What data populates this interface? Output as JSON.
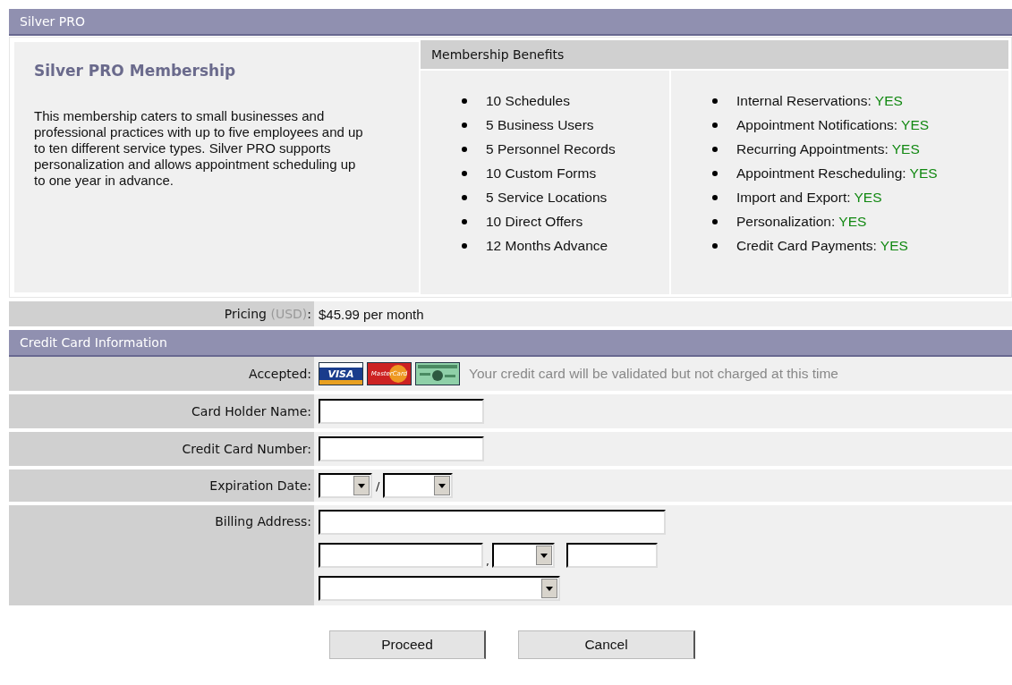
{
  "header": {
    "title": "Silver PRO"
  },
  "plan": {
    "title": "Silver PRO Membership",
    "description": "This membership caters to small businesses and professional practices with up to five employees and up to ten different service types. Silver PRO supports personalization and allows appointment scheduling up to one year in advance."
  },
  "benefits": {
    "title": "Membership Benefits",
    "limits": [
      "10 Schedules",
      "5 Business Users",
      "5 Personnel Records",
      "10 Custom Forms",
      "5 Service Locations",
      "10 Direct Offers",
      "12 Months Advance"
    ],
    "features": [
      {
        "label": "Internal Reservations:",
        "value": "YES"
      },
      {
        "label": "Appointment Notifications:",
        "value": "YES"
      },
      {
        "label": "Recurring Appointments:",
        "value": "YES"
      },
      {
        "label": "Appointment Rescheduling:",
        "value": "YES"
      },
      {
        "label": "Import and Export:",
        "value": "YES"
      },
      {
        "label": "Personalization:",
        "value": "YES"
      },
      {
        "label": "Credit Card Payments:",
        "value": "YES"
      }
    ]
  },
  "pricing": {
    "label": "Pricing",
    "unit": "(USD)",
    "colon": ":",
    "value": "$45.99 per month"
  },
  "credit_card": {
    "title": "Credit Card Information",
    "accepted_label": "Accepted:",
    "cards": [
      {
        "kind": "visa",
        "label": "VISA"
      },
      {
        "kind": "mastercard",
        "label": "MasterCard"
      },
      {
        "kind": "amex"
      }
    ],
    "note": "Your credit card will be validated but not charged at this time",
    "card_holder_label": "Card Holder Name:",
    "card_number_label": "Credit Card Number:",
    "expiration_label": "Expiration Date:",
    "expiration_separator": "/",
    "billing_label": "Billing Address:",
    "city_separator": ","
  },
  "buttons": [
    "Proceed",
    "Cancel"
  ]
}
